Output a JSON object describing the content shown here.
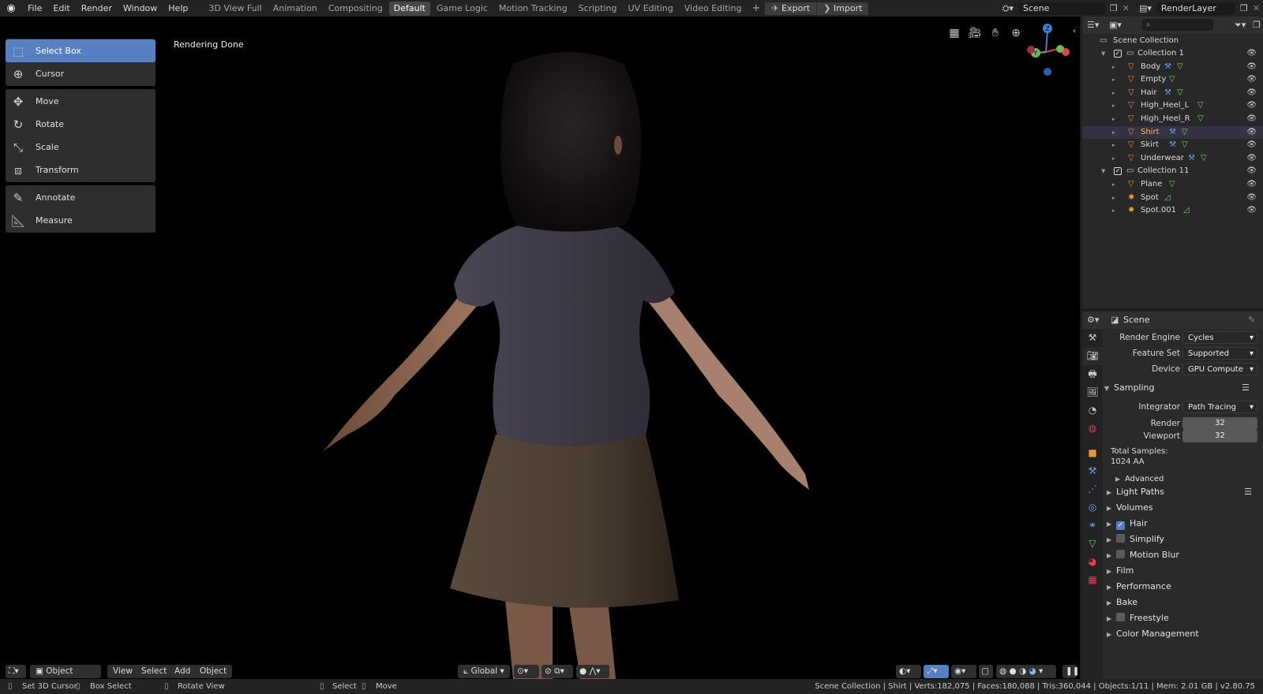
{
  "topbar": {
    "menus": [
      "File",
      "Edit",
      "Render",
      "Window",
      "Help"
    ],
    "workspaces": [
      "3D View Full",
      "Animation",
      "Compositing",
      "Default",
      "Game Logic",
      "Motion Tracking",
      "Scripting",
      "UV Editing",
      "Video Editing"
    ],
    "active_workspace": "Default",
    "add_tab": "+",
    "export_label": "Export",
    "import_label": "Import",
    "scene_name": "Scene",
    "view_layer": "RenderLayer"
  },
  "tools": {
    "groups": [
      [
        {
          "label": "Select Box",
          "icon": "select-box-icon",
          "active": true
        },
        {
          "label": "Cursor",
          "icon": "cursor-icon"
        }
      ],
      [
        {
          "label": "Move",
          "icon": "move-icon"
        },
        {
          "label": "Rotate",
          "icon": "rotate-icon"
        },
        {
          "label": "Scale",
          "icon": "scale-icon"
        },
        {
          "label": "Transform",
          "icon": "transform-icon"
        }
      ],
      [
        {
          "label": "Annotate",
          "icon": "annotate-icon"
        },
        {
          "label": "Measure",
          "icon": "measure-icon"
        }
      ]
    ]
  },
  "viewport": {
    "status": "Rendering Done",
    "header": {
      "mode": "Object Mode",
      "menus": [
        "View",
        "Select",
        "Add",
        "Object"
      ],
      "orientation": "Global"
    },
    "gizmo": {
      "z": "Z",
      "y": "Y"
    }
  },
  "outliner": {
    "root": "Scene Collection",
    "rows": [
      {
        "label": "Collection 1",
        "type": "collection",
        "indent": 1
      },
      {
        "label": "Body",
        "type": "mesh",
        "indent": 2,
        "mod": true
      },
      {
        "label": "Empty",
        "type": "mesh",
        "indent": 2
      },
      {
        "label": "Hair",
        "type": "mesh",
        "indent": 2,
        "mod": true
      },
      {
        "label": "High_Heel_L",
        "type": "mesh",
        "indent": 2
      },
      {
        "label": "High_Heel_R",
        "type": "mesh",
        "indent": 2
      },
      {
        "label": "Shirt",
        "type": "mesh",
        "indent": 2,
        "mod": true,
        "selected": true
      },
      {
        "label": "Skirt",
        "type": "mesh",
        "indent": 2,
        "mod": true
      },
      {
        "label": "Underwear",
        "type": "mesh",
        "indent": 2,
        "mod": true
      },
      {
        "label": "Collection 11",
        "type": "collection",
        "indent": 1
      },
      {
        "label": "Plane",
        "type": "mesh",
        "indent": 2
      },
      {
        "label": "Spot",
        "type": "light",
        "indent": 2
      },
      {
        "label": "Spot.001",
        "type": "light",
        "indent": 2
      }
    ]
  },
  "properties": {
    "context": "Scene",
    "render_engine_label": "Render Engine",
    "render_engine": "Cycles",
    "feature_set_label": "Feature Set",
    "feature_set": "Supported",
    "device_label": "Device",
    "device": "GPU Compute",
    "sampling": "Sampling",
    "integrator_label": "Integrator",
    "integrator": "Path Tracing",
    "render_label": "Render",
    "render_samples": "32",
    "viewport_label": "Viewport",
    "viewport_samples": "32",
    "total_samples_label": "Total Samples:",
    "total_samples": "1024 AA",
    "advanced": "Advanced",
    "sections": [
      {
        "label": "Light Paths"
      },
      {
        "label": "Volumes"
      },
      {
        "label": "Hair",
        "check": true,
        "checked": true
      },
      {
        "label": "Simplify",
        "check": true,
        "checked": false
      },
      {
        "label": "Motion Blur",
        "check": true,
        "checked": false
      },
      {
        "label": "Film"
      },
      {
        "label": "Performance"
      },
      {
        "label": "Bake"
      },
      {
        "label": "Freestyle",
        "check": true,
        "checked": false
      },
      {
        "label": "Color Management"
      }
    ]
  },
  "statusbar": {
    "left": [
      "Set 3D Cursor",
      "Box Select",
      "Rotate View"
    ],
    "mid": [
      "Select",
      "Move"
    ],
    "info": "Scene Collection | Shirt | Verts:182,075 | Faces:180,088 | Tris:360,044 | Objects:1/11 | Mem: 2.01 GB | v2.80.75"
  },
  "colors": {
    "accent": "#5680c2",
    "selected_text": "#ffb86c",
    "mesh_icon": "#e8953c",
    "modifier_icon": "#6a9ee8",
    "data_icon": "#7dd36b"
  }
}
